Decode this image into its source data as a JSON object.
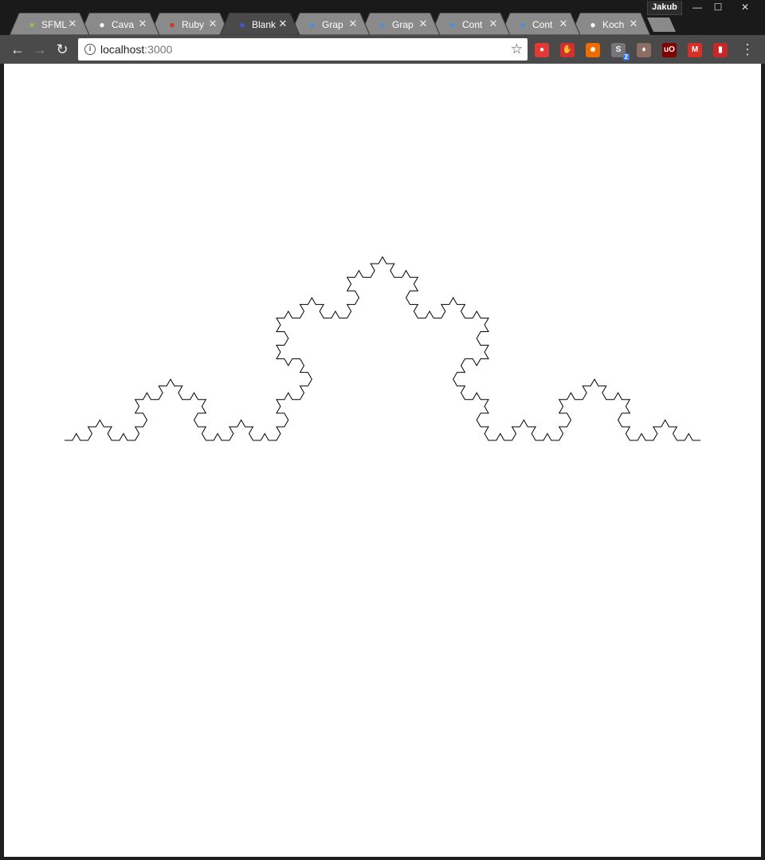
{
  "window": {
    "profile_name": "Jakub",
    "controls": {
      "minimize": "—",
      "maximize": "☐",
      "close": "✕"
    }
  },
  "tabs": [
    {
      "title": "SFML",
      "favicon": "sfml-power-icon",
      "color": "#8bc34a",
      "active": false
    },
    {
      "title": "Cava",
      "favicon": "github-icon",
      "color": "#ffffff",
      "active": false
    },
    {
      "title": "Ruby",
      "favicon": "ruby-icon",
      "color": "#cc342d",
      "active": false
    },
    {
      "title": "Blank",
      "favicon": "blank-app-icon",
      "color": "#3b5bdb",
      "active": true
    },
    {
      "title": "Grap",
      "favicon": "graphql-chevron-icon",
      "color": "#4a90e2",
      "active": false
    },
    {
      "title": "Grap",
      "favicon": "graphql-chevron-icon",
      "color": "#4a90e2",
      "active": false
    },
    {
      "title": "Cont",
      "favicon": "graphql-chevron-icon",
      "color": "#4a90e2",
      "active": false
    },
    {
      "title": "Cont",
      "favicon": "graphql-chevron-icon",
      "color": "#4a90e2",
      "active": false
    },
    {
      "title": "Koch",
      "favicon": "wikipedia-icon",
      "color": "#ffffff",
      "active": false
    }
  ],
  "tab_close_glyph": "✕",
  "toolbar": {
    "back": "←",
    "forward": "→",
    "reload": "↻",
    "url_host": "localhost",
    "url_port": ":3000",
    "info_glyph": "i",
    "bookmark_glyph": "☆",
    "menu_glyph": "⋮"
  },
  "extensions": [
    {
      "name": "tomato-extension-icon",
      "color": "#e53935",
      "glyph": "●"
    },
    {
      "name": "adblock-extension-icon",
      "color": "#d32f2f",
      "glyph": "✋"
    },
    {
      "name": "fox-extension-icon",
      "color": "#ef6c00",
      "glyph": "☻"
    },
    {
      "name": "s-extension-icon",
      "color": "#757575",
      "glyph": "S",
      "badge": "2"
    },
    {
      "name": "cow-extension-icon",
      "color": "#8d6e63",
      "glyph": "♦"
    },
    {
      "name": "ublock-extension-icon",
      "color": "#800000",
      "glyph": "uO"
    },
    {
      "name": "gmail-extension-icon",
      "color": "#d93025",
      "glyph": "M"
    },
    {
      "name": "book-extension-icon",
      "color": "#c62828",
      "glyph": "▮"
    }
  ],
  "page": {
    "background": "#ffffff",
    "figure": "koch-curve",
    "iterations": 4,
    "stroke": "#000000"
  }
}
